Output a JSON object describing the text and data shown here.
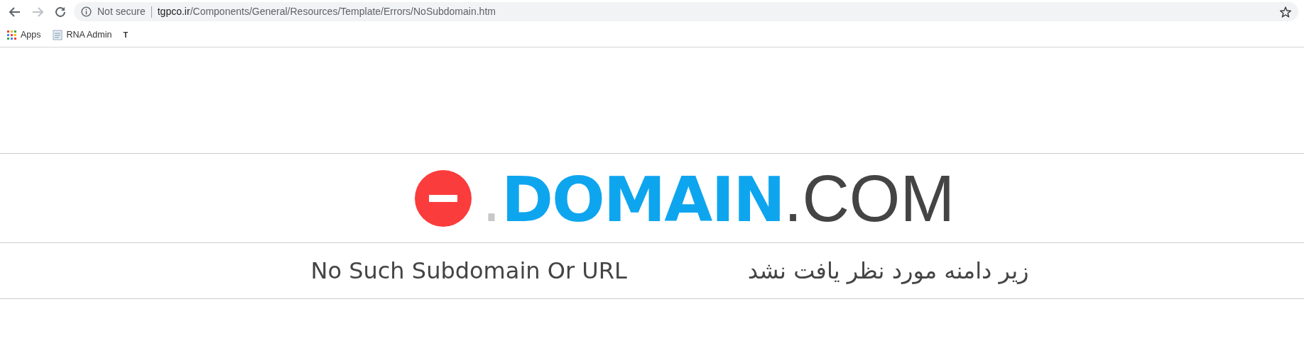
{
  "browser": {
    "address": {
      "security": "Not secure",
      "host": "tgpco.ir",
      "path": "/Components/General/Resources/Template/Errors/NoSubdomain.htm"
    },
    "bookmarks": [
      {
        "kind": "apps",
        "label": "Apps"
      },
      {
        "kind": "page",
        "label": "RNA Admin"
      },
      {
        "kind": "favicon",
        "label": "T"
      }
    ]
  },
  "logo": {
    "parts": [
      {
        "kind": "dot",
        "text": "."
      },
      {
        "kind": "name",
        "text": "DOMAIN"
      },
      {
        "kind": "tld",
        "text": ".COM"
      }
    ]
  },
  "messages": [
    {
      "text": "No Such Subdomain Or URL"
    },
    {
      "text": "زیر دامنه مورد نظر یافت نشد"
    }
  ]
}
